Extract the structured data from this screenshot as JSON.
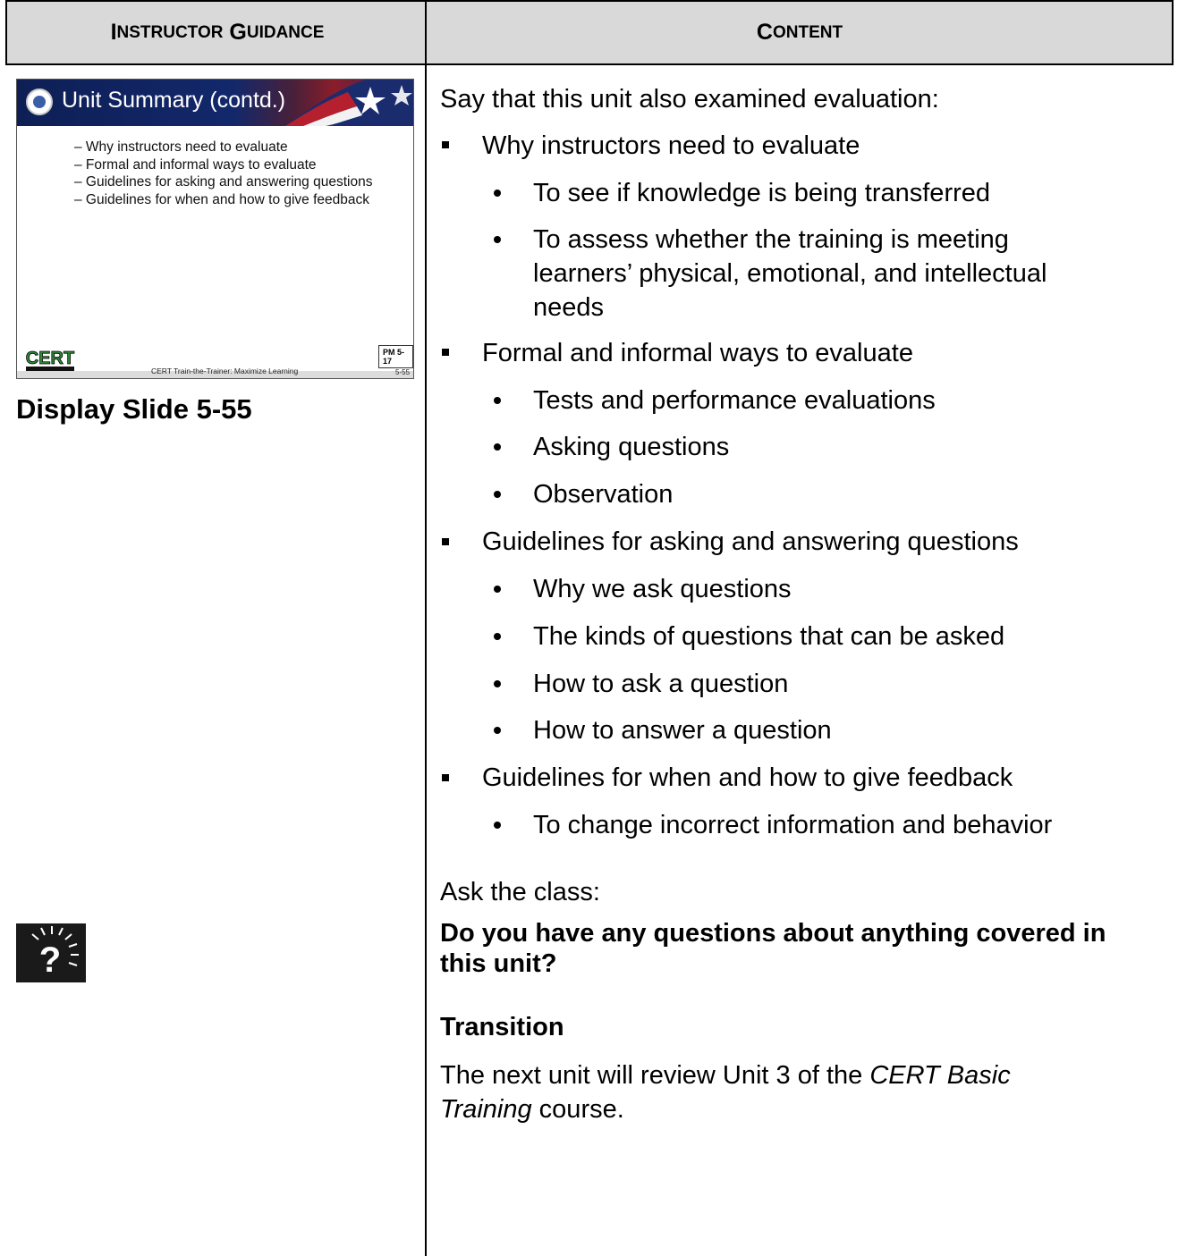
{
  "header": {
    "col1_first": "I",
    "col1_rest1": "NSTRUCTOR",
    "col1_first2": "G",
    "col1_rest2": "UIDANCE",
    "col2_first": "C",
    "col2_rest": "ONTENT"
  },
  "slide": {
    "title": "Unit Summary (contd.)",
    "bullets": [
      "– Why instructors need to evaluate",
      "– Formal and informal ways to evaluate",
      "– Guidelines for asking and answering questions",
      "– Guidelines for when and how to give feedback"
    ],
    "pm_label": "PM 5-17",
    "footer_caption": "CERT Train-the-Trainer: Maximize Learning",
    "slide_number": "5-55",
    "logo_text": "CERT"
  },
  "left": {
    "display_slide": "Display Slide 5-55"
  },
  "content": {
    "intro": "Say that this unit also examined evaluation:",
    "items": [
      {
        "label": "Why instructors need to evaluate",
        "subs": [
          "To see if knowledge is being transferred",
          "To assess whether the training is meeting learners’ physical, emotional, and intellectual needs"
        ]
      },
      {
        "label": "Formal and informal ways to evaluate",
        "subs": [
          "Tests and performance evaluations",
          "Asking questions",
          "Observation"
        ]
      },
      {
        "label": "Guidelines for asking and answering questions",
        "subs": [
          "Why we ask questions",
          "The kinds of questions that can be asked",
          "How to ask a question",
          "How to answer a question"
        ]
      },
      {
        "label": "Guidelines for when and how to give feedback",
        "subs": [
          "To change incorrect information and behavior"
        ]
      }
    ],
    "ask": "Ask the class:",
    "question": "Do you have any questions about anything covered in this unit?",
    "transition_heading": "Transition",
    "transition_pre": "The next unit will review Unit 3 of the ",
    "transition_italic": "CERT Basic Training",
    "transition_post": " course."
  }
}
